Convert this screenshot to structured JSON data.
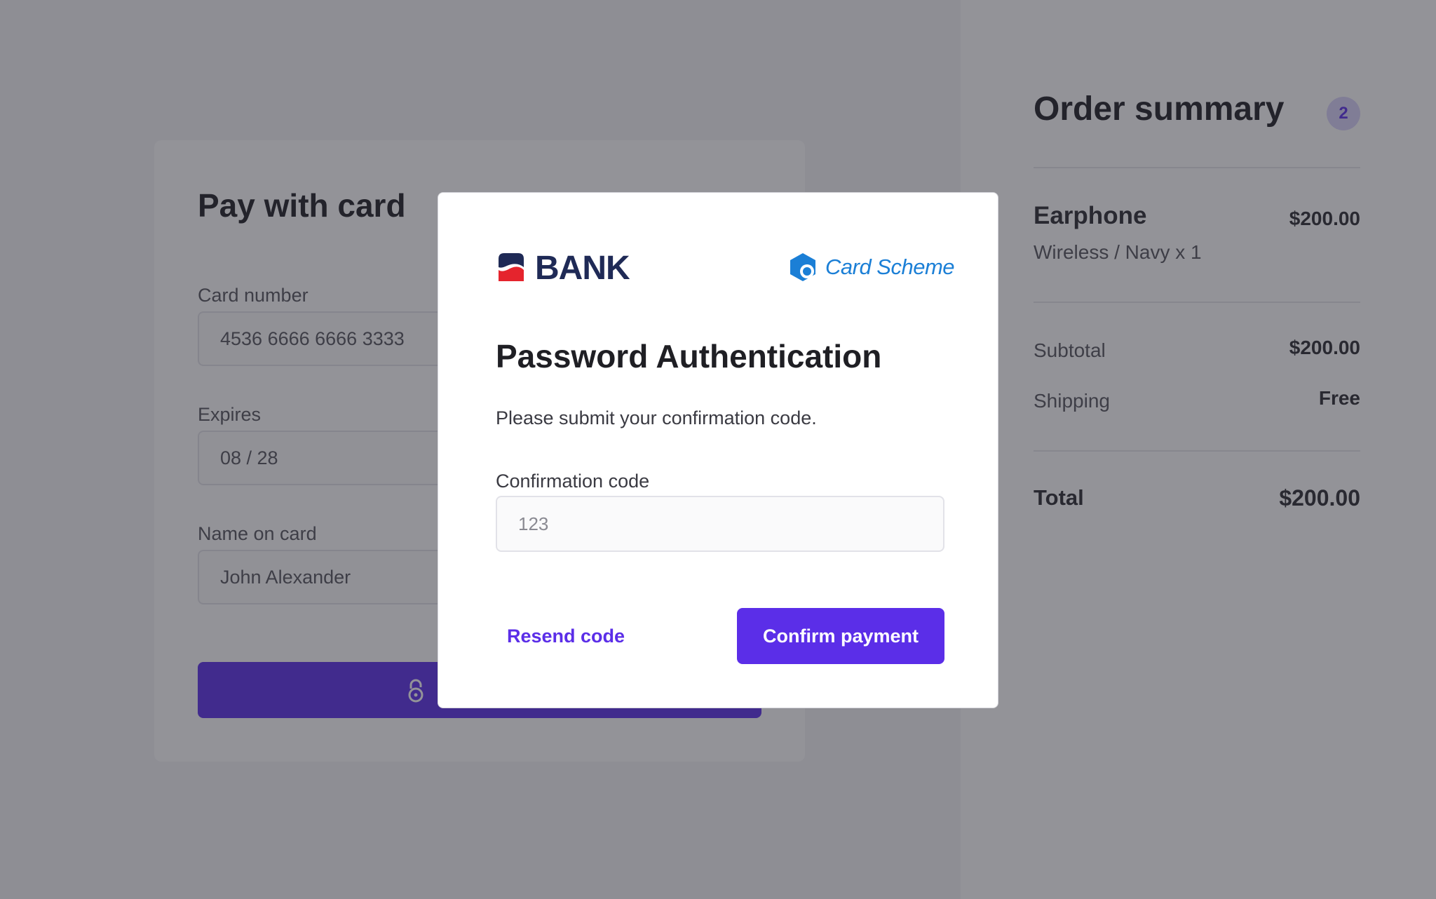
{
  "checkout": {
    "title": "Pay with card",
    "card_number_label": "Card number",
    "card_number_value": "4536 6666 6666 3333",
    "expires_label": "Expires",
    "expires_value": "08 / 28",
    "name_label": "Name on card",
    "name_value": "John Alexander",
    "pay_button_icon": "lock-icon"
  },
  "summary": {
    "title": "Order summary",
    "item_count": "2",
    "item_name": "Earphone",
    "item_detail": "Wireless / Navy x 1",
    "item_price": "$200.00",
    "subtotal_label": "Subtotal",
    "subtotal_value": "$200.00",
    "shipping_label": "Shipping",
    "shipping_value": "Free",
    "total_label": "Total",
    "total_value": "$200.00"
  },
  "modal": {
    "bank_name": "BANK",
    "scheme_name": "Card Scheme",
    "title": "Password Authentication",
    "description": "Please submit your confirmation code.",
    "code_label": "Confirmation code",
    "code_placeholder": "123",
    "resend_label": "Resend code",
    "confirm_label": "Confirm payment"
  },
  "colors": {
    "accent": "#5b2ee8",
    "bank_navy": "#1f2a56",
    "bank_red": "#e5242d",
    "scheme_blue": "#1b7fd6",
    "overlay": "rgba(40,40,50,0.5)"
  }
}
